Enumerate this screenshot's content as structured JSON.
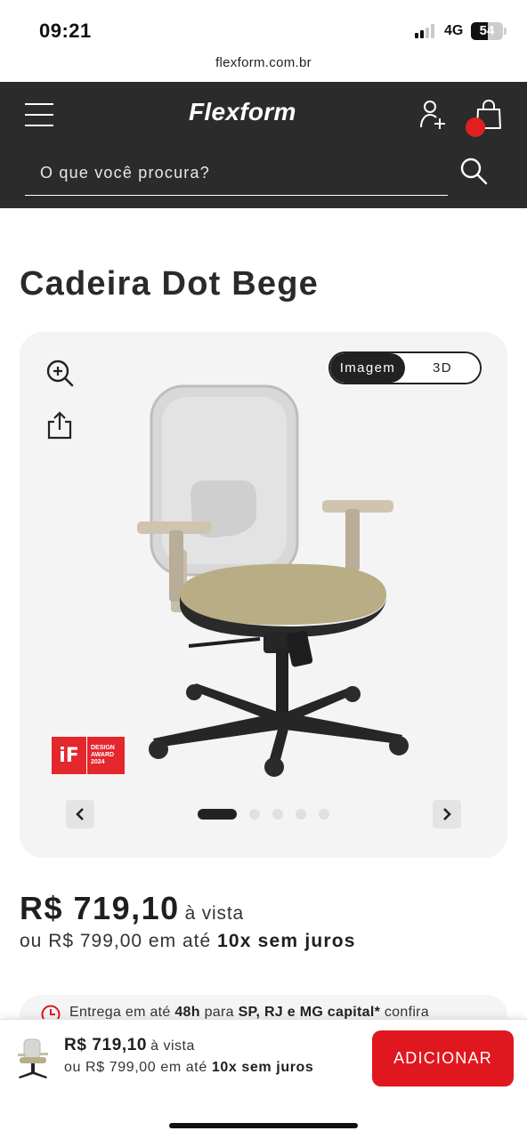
{
  "status_bar": {
    "time": "09:21",
    "network": "4G",
    "battery": "54",
    "battery_level": 0.54,
    "signal_bars": 2
  },
  "browser": {
    "url": "flexform.com.br"
  },
  "header": {
    "logo": "Flexform",
    "icons": [
      "menu-icon",
      "user-add-icon",
      "shopping-bag-icon",
      "search-icon"
    ],
    "search_placeholder": "O que você procura?",
    "cart_dot_color": "#e0201e"
  },
  "product": {
    "title": "Cadeira Dot Bege",
    "gallery": {
      "view_options": [
        "Imagem",
        "3D"
      ],
      "active_view": "Imagem",
      "award": {
        "logo": "iF",
        "lines": [
          "DESIGN",
          "AWARD",
          "2024"
        ]
      },
      "slide_count": 5,
      "active_slide": 1
    },
    "price": {
      "main": "R$ 719,10",
      "suffix": "à vista",
      "installment_prefix": "ou R$ 799,00 em até",
      "installment_bold": "10x sem juros"
    },
    "delivery": {
      "prefix": "Entrega em até",
      "time": "48h",
      "middle": "para",
      "regions": "SP, RJ e MG capital*",
      "suffix": "confira"
    }
  },
  "sticky_bar": {
    "price_main": "R$ 719,10",
    "price_suffix": "à vista",
    "installment_prefix": "ou R$ 799,00 em até",
    "installment_bold": "10x sem juros",
    "add_label": "ADICIONAR",
    "add_color": "#e0171f"
  }
}
